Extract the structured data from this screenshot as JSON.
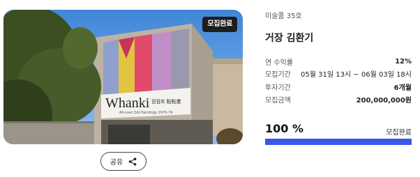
{
  "hero": {
    "badge": "모집완료",
    "banner_title": "Whanki",
    "banner_title_ko": "김환기",
    "banner_subtitle_ko": "점점화 點點畫",
    "banner_subtitle": "All-over Dot Paintings 1970-74"
  },
  "share": {
    "label": "공유"
  },
  "info": {
    "category": "미술품 35호",
    "title": "거장 김환기",
    "rows": [
      {
        "label": "연 수익률",
        "value": "12%"
      },
      {
        "label": "모집기간",
        "value": "05월 31일 13시 ~ 06월 03일 18시"
      },
      {
        "label": "투자기간",
        "value": "6개월"
      },
      {
        "label": "모집금액",
        "value": "200,000,000원"
      }
    ],
    "progress_label": "100 %",
    "progress_value": 1.0,
    "status": "모집완료"
  },
  "colors": {
    "accent": "#3a57e8",
    "badge_bg": "#1d1d1f"
  }
}
